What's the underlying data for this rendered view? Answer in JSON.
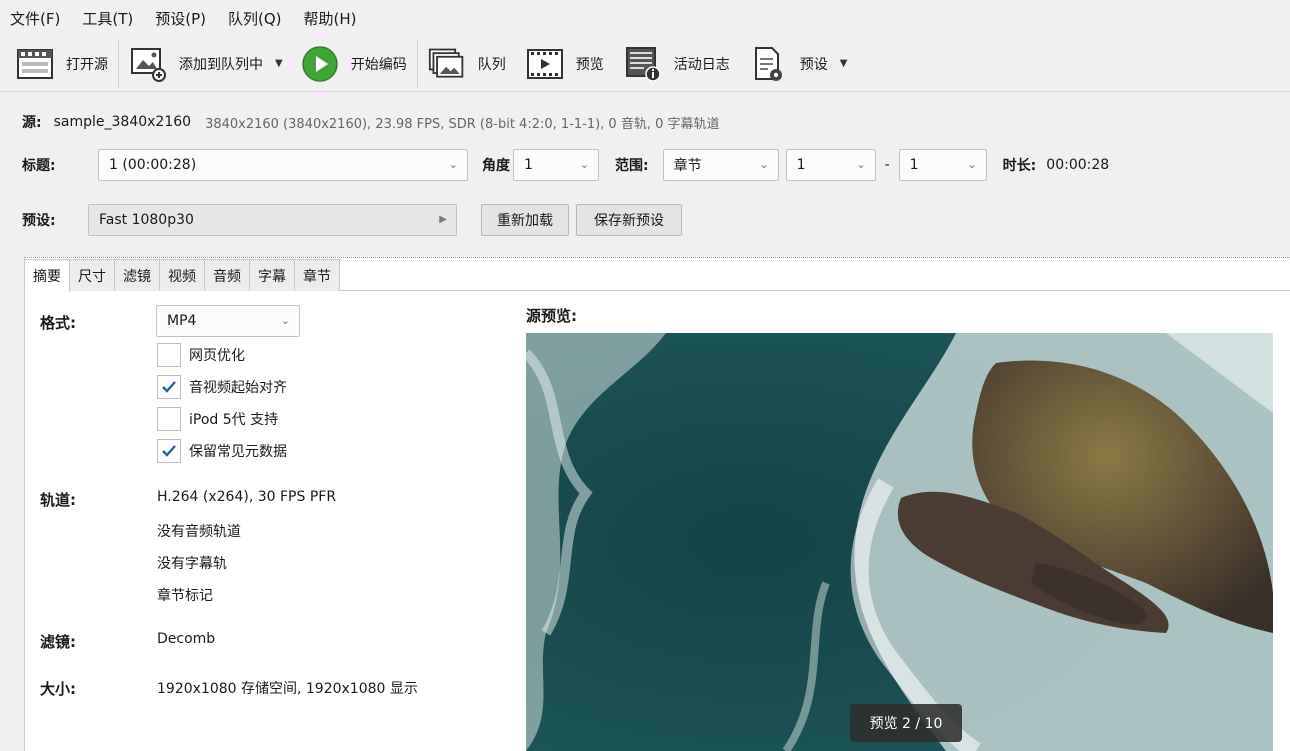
{
  "menu": [
    "文件(F)",
    "工具(T)",
    "预设(P)",
    "队列(Q)",
    "帮助(H)"
  ],
  "toolbar": {
    "open_source": "打开源",
    "add_to_queue": "添加到队列中",
    "start_encode": "开始编码",
    "queue": "队列",
    "preview": "预览",
    "activity_log": "活动日志",
    "presets": "预设"
  },
  "source": {
    "label": "源:",
    "name": "sample_3840x2160",
    "meta": "3840x2160 (3840x2160), 23.98 FPS, SDR (8-bit 4:2:0, 1-1-1), 0 音轨, 0 字幕轨道"
  },
  "title_row": {
    "title_label": "标题:",
    "title_value": "1 (00:00:28)",
    "angle_label": "角度",
    "angle_value": "1",
    "range_label": "范围:",
    "range_value": "章节",
    "range_start": "1",
    "dash": "-",
    "range_end": "1",
    "duration_label": "时长:",
    "duration_value": "00:00:28"
  },
  "preset_row": {
    "label": "预设:",
    "value": "Fast 1080p30",
    "reload": "重新加载",
    "save_new": "保存新预设"
  },
  "tabs": [
    "摘要",
    "尺寸",
    "滤镜",
    "视频",
    "音频",
    "字幕",
    "章节"
  ],
  "summary": {
    "format_label": "格式:",
    "format_value": "MP4",
    "checkboxes": [
      {
        "label": "网页优化",
        "checked": false
      },
      {
        "label": "音视频起始对齐",
        "checked": true
      },
      {
        "label": "iPod 5代 支持",
        "checked": false
      },
      {
        "label": "保留常见元数据",
        "checked": true
      }
    ],
    "tracks_label": "轨道:",
    "tracks": [
      "H.264 (x264), 30 FPS PFR",
      "没有音频轨道",
      "没有字幕轨",
      "章节标记"
    ],
    "filters_label": "滤镜:",
    "filters_value": "Decomb",
    "size_label": "大小:",
    "size_value": "1920x1080 存储空间, 1920x1080 显示",
    "preview_label": "源预览:",
    "preview_badge": "预览 2 / 10"
  },
  "colors": {
    "play_green": "#3fa535",
    "check_blue": "#1f5fa8",
    "sea_dark": "#1d4f52"
  }
}
